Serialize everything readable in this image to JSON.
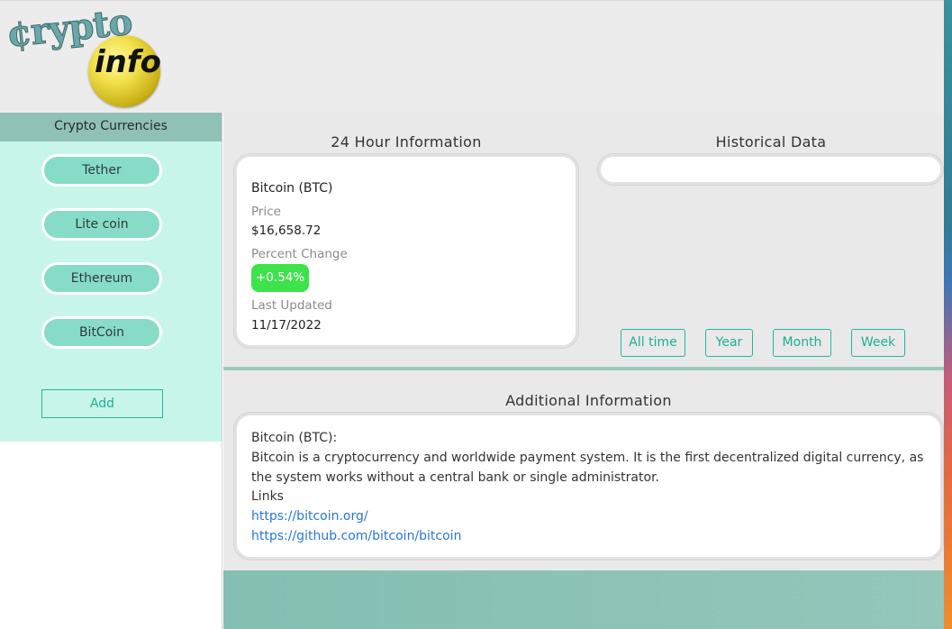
{
  "header": {
    "logo_primary": "¢rypto",
    "logo_secondary": "info"
  },
  "sidebar": {
    "title": "Crypto Currencies",
    "coins": [
      "Tether",
      "Lite coin",
      "Ethereum",
      "BitCoin"
    ],
    "add_label": "Add"
  },
  "hour24": {
    "title": "24 Hour Information",
    "coin": "Bitcoin (BTC)",
    "price_label": "Price",
    "price": "$16,658.72",
    "pct_label": "Percent Change",
    "pct": "+0.54%",
    "updated_label": "Last Updated",
    "updated": "11/17/2022"
  },
  "historical": {
    "title": "Historical Data",
    "ranges": [
      "All time",
      "Year",
      "Month",
      "Week"
    ]
  },
  "additional": {
    "title": "Additional Information",
    "heading": "Bitcoin (BTC):",
    "description": "Bitcoin is a cryptocurrency and worldwide payment system. It is the first decentralized digital currency, as the system works without a central bank or single administrator.",
    "links_label": "Links",
    "links": [
      "https://bitcoin.org/",
      "https://github.com/bitcoin/bitcoin"
    ]
  },
  "colors": {
    "accent": "#1fae93",
    "sidebar_bg": "#c8f5ea",
    "coin_button": "#86dcc7",
    "positive": "#3ee24b",
    "link": "#2a76d2"
  }
}
